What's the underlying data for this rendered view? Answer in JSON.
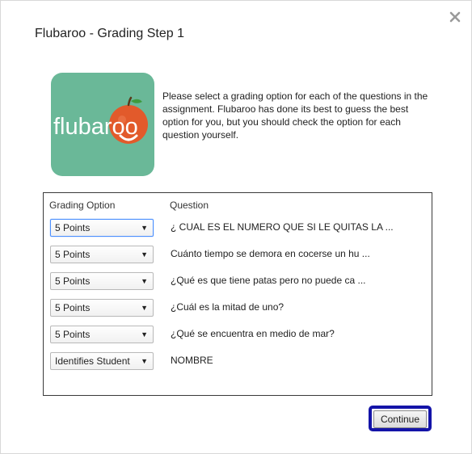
{
  "dialog": {
    "title": "Flubaroo - Grading Step 1",
    "close_icon": "close-icon",
    "logo_text": "flubaroo",
    "intro_text": "Please select a grading option for each of the questions in the assignment. Flubaroo has done its best to guess the best option for you, but you should check the option for each question yourself.",
    "colors": {
      "logo_bg": "#6ab898",
      "apple": "#e25a2b",
      "continue_highlight": "#1414a8"
    }
  },
  "table": {
    "header_option": "Grading Option",
    "header_question": "Question",
    "rows": [
      {
        "option": "5 Points",
        "question": "¿ CUAL ES EL NUMERO QUE SI LE QUITAS LA ..."
      },
      {
        "option": "5 Points",
        "question": "Cuánto tiempo se demora en cocerse un hu ..."
      },
      {
        "option": "5 Points",
        "question": "¿Qué es que tiene patas pero no puede ca ..."
      },
      {
        "option": "5 Points",
        "question": "¿Cuál es la mitad de uno?"
      },
      {
        "option": "5 Points",
        "question": "¿Qué se encuentra en medio de mar?"
      },
      {
        "option": "Identifies Student",
        "question": "NOMBRE"
      }
    ],
    "dropdown_arrow": "▼"
  },
  "footer": {
    "continue_label": "Continue"
  }
}
